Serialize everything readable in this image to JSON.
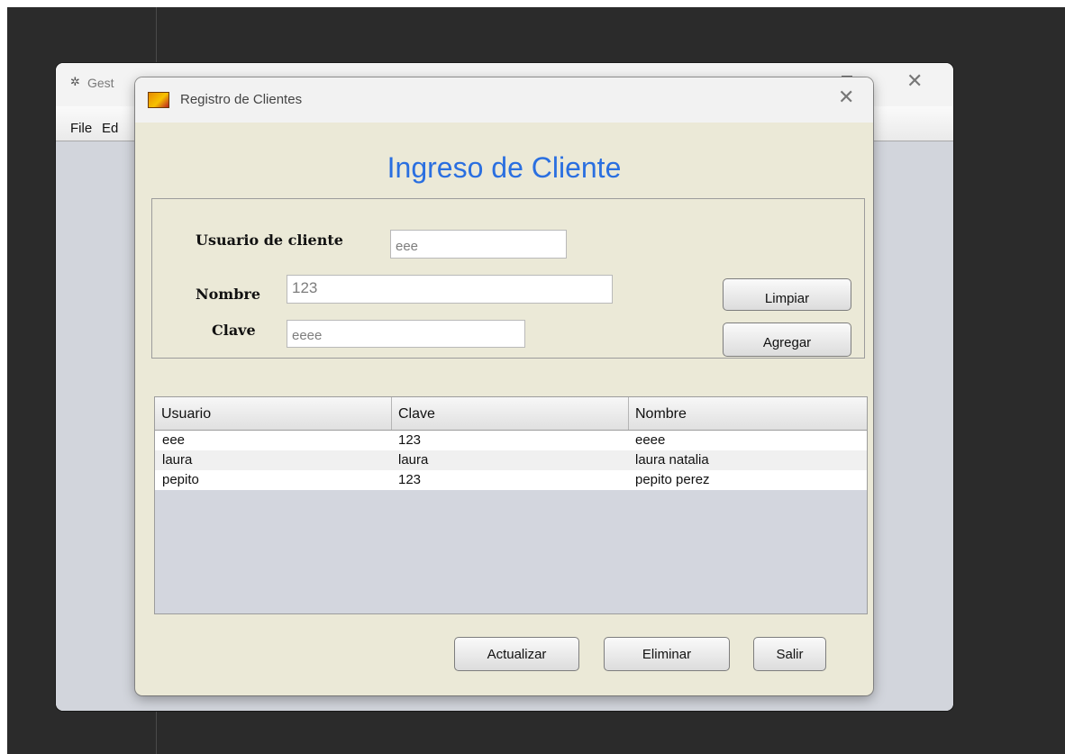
{
  "parent_window": {
    "title": "Gest",
    "menu": [
      "File",
      "Ed"
    ]
  },
  "dialog": {
    "title": "Registro de Clientes",
    "heading": "Ingreso de Cliente",
    "form": {
      "usuario_label": "Usuario de cliente",
      "usuario_value": "eee",
      "nombre_label": "Nombre",
      "nombre_value": "123",
      "clave_label": "Clave",
      "clave_value": "eeee"
    },
    "buttons": {
      "limpiar": "Limpiar",
      "agregar": "Agregar",
      "actualizar": "Actualizar",
      "eliminar": "Eliminar",
      "salir": "Salir"
    },
    "table": {
      "columns": [
        "Usuario",
        "Clave",
        "Nombre"
      ],
      "rows": [
        [
          "eee",
          "123",
          "eeee"
        ],
        [
          "laura",
          "laura",
          "laura natalia"
        ],
        [
          "pepito",
          "123",
          "pepito perez"
        ]
      ]
    }
  },
  "colors": {
    "heading": "#2a6fe0",
    "dialog_bg": "#ebe9d7",
    "table_empty_bg": "#d3d6de"
  }
}
